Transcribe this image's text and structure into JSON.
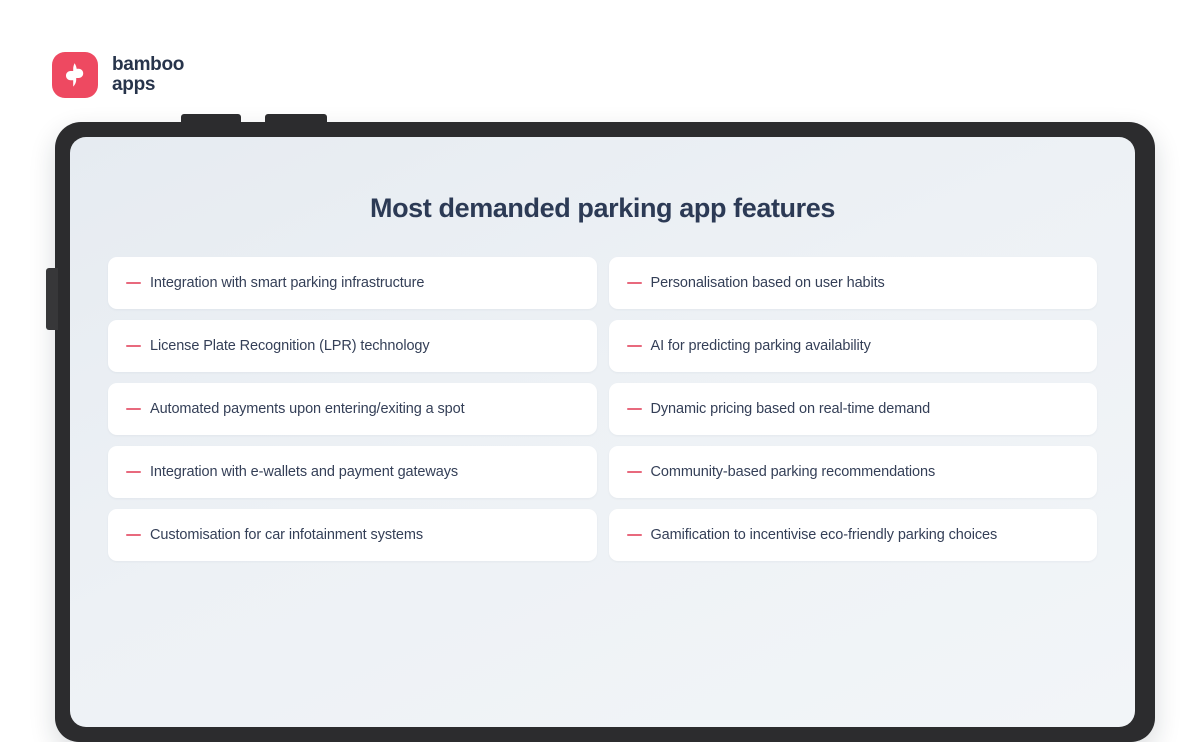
{
  "brand": {
    "logo_icon": "bamboo-apps-mark",
    "name_line1": "bamboo",
    "name_line2": "apps",
    "mark_color": "#EE4961",
    "wordmark_color": "#27344B"
  },
  "device": {
    "type": "tablet-frame",
    "body_color": "#2C2C2E",
    "screen_gradient_from": "#E6EBF1",
    "screen_gradient_to": "#F2F5F8",
    "buttons": [
      {
        "name": "volume-up-button"
      },
      {
        "name": "volume-down-button"
      },
      {
        "name": "power-button"
      }
    ]
  },
  "slide": {
    "title": "Most demanded parking app features",
    "title_color": "#2C3A55",
    "marker_color": "#E8697D",
    "card_background": "#FFFFFF",
    "features_left": [
      "Integration with smart parking infrastructure",
      "License Plate Recognition (LPR) technology",
      "Automated payments upon entering/exiting a spot",
      "Integration with e-wallets and payment gateways",
      "Customisation for car infotainment systems"
    ],
    "features_right": [
      "Personalisation based on user habits",
      "AI for predicting parking availability",
      "Dynamic pricing based on real-time demand",
      "Community-based parking recommendations",
      "Gamification to incentivise eco-friendly parking choices"
    ]
  }
}
